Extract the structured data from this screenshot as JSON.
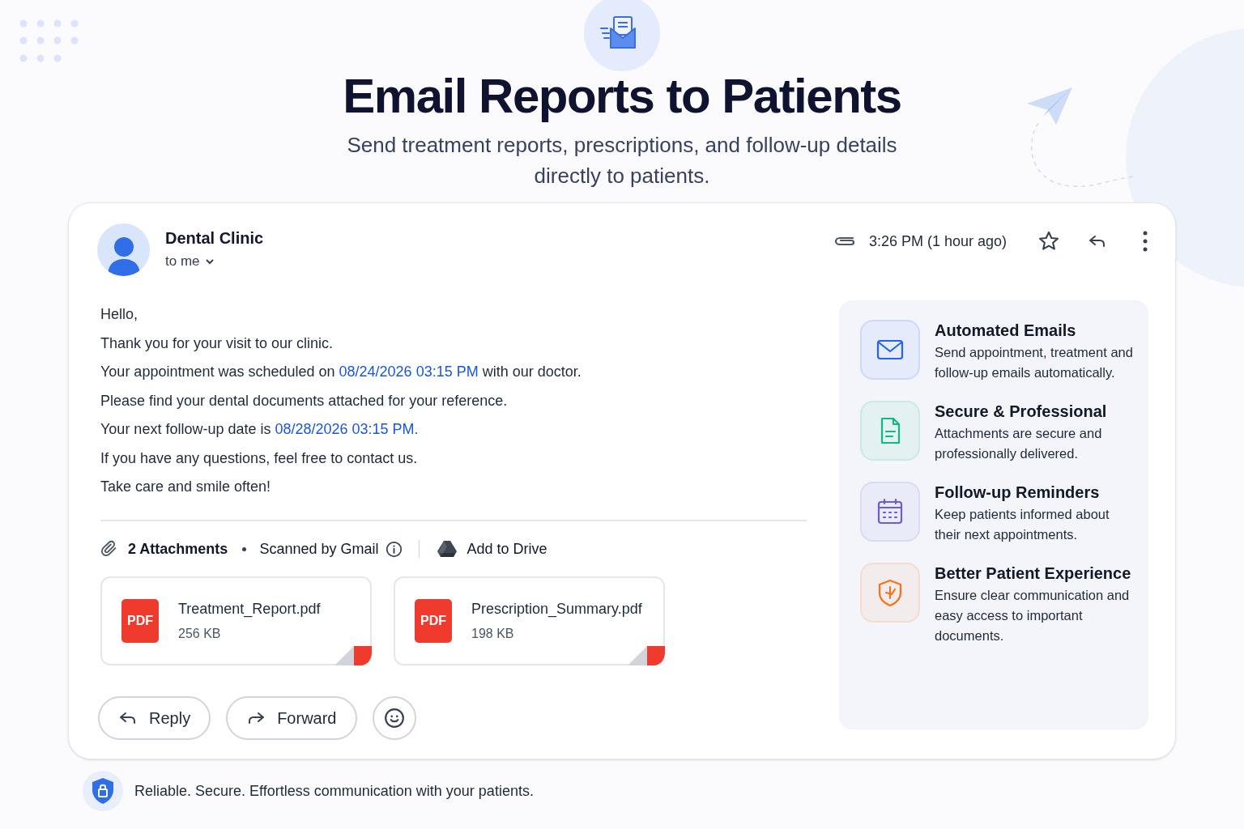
{
  "header": {
    "title": "Email Reports to Patients",
    "subtitle": "Send treatment reports, prescriptions, and follow-up details directly to patients."
  },
  "email": {
    "sender": "Dental Clinic",
    "recipient": "to me",
    "time": "3:26 PM (1 hour ago)",
    "starred": false,
    "body": [
      {
        "segments": [
          {
            "kind": "text",
            "text": "Hello,"
          }
        ]
      },
      {
        "segments": [
          {
            "kind": "text",
            "text": "Thank you for your visit to our clinic."
          }
        ]
      },
      {
        "segments": [
          {
            "kind": "text",
            "text": "Your appointment was scheduled on "
          },
          {
            "kind": "link",
            "text": "08/24/2026 03:15 PM"
          },
          {
            "kind": "text",
            "text": " with our doctor."
          }
        ]
      },
      {
        "segments": [
          {
            "kind": "text",
            "text": "Please find your dental documents attached for your reference."
          }
        ]
      },
      {
        "segments": [
          {
            "kind": "text",
            "text": "Your next follow-up date is "
          },
          {
            "kind": "link",
            "text": "08/28/2026 03:15 PM."
          }
        ]
      },
      {
        "segments": [
          {
            "kind": "text",
            "text": "If you have any questions, feel free to contact us."
          }
        ]
      },
      {
        "segments": [
          {
            "kind": "text",
            "text": "Take care and smile often!"
          }
        ]
      }
    ],
    "attachments_label": "2 Attachments",
    "scanned": "Scanned by Gmail",
    "drive": "Add to Drive",
    "attachments": [
      {
        "type": "PDF",
        "name": "Treatment_Report.pdf",
        "size": "256 KB"
      },
      {
        "type": "PDF",
        "name": "Prescription_Summary.pdf",
        "size": "198 KB"
      }
    ],
    "actions": [
      {
        "kind": "reply",
        "label": "Reply"
      },
      {
        "kind": "forward",
        "label": "Forward"
      },
      {
        "kind": "emoji"
      }
    ]
  },
  "features": [
    {
      "kind": "mail",
      "color": "#2563eb",
      "title": "Automated Emails",
      "text": "Send appointment, treatment and follow-up emails automatically."
    },
    {
      "kind": "document",
      "color": "#10b981",
      "title": "Secure & Professional",
      "text": "Attachments are secure and professionally delivered."
    },
    {
      "kind": "calendar",
      "color": "#6d5bd0",
      "title": "Follow-up Reminders",
      "text": "Keep patients informed about their next appointments."
    },
    {
      "kind": "shield",
      "color": "#f97316",
      "title": "Better Patient Experience",
      "text": "Ensure clear communication and easy access to important documents."
    }
  ],
  "footer": "Reliable. Secure. Effortless communication with your patients."
}
